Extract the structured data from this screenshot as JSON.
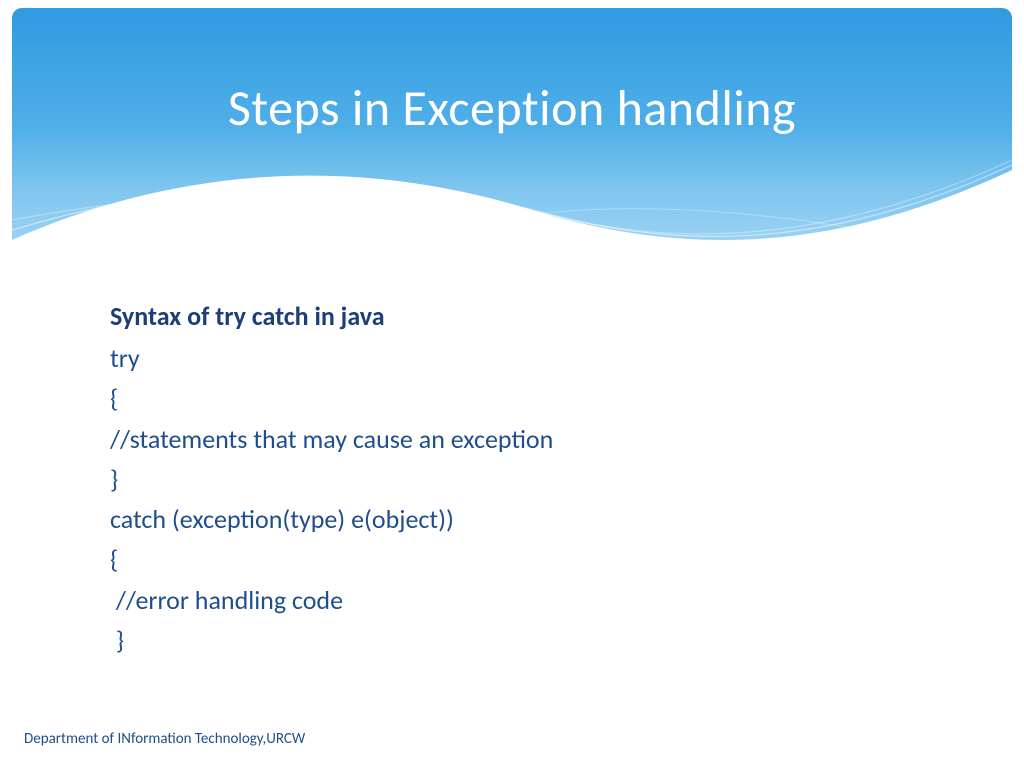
{
  "header": {
    "title": "Steps in Exception handling"
  },
  "content": {
    "subtitle": "Syntax of try catch in java",
    "lines": [
      "try",
      "{",
      "//statements that may cause an exception",
      "}",
      "catch (exception(type) e(object))",
      "{",
      " //error handling code",
      " }"
    ]
  },
  "footer": {
    "text": "Department of INformation Technology,URCW"
  }
}
